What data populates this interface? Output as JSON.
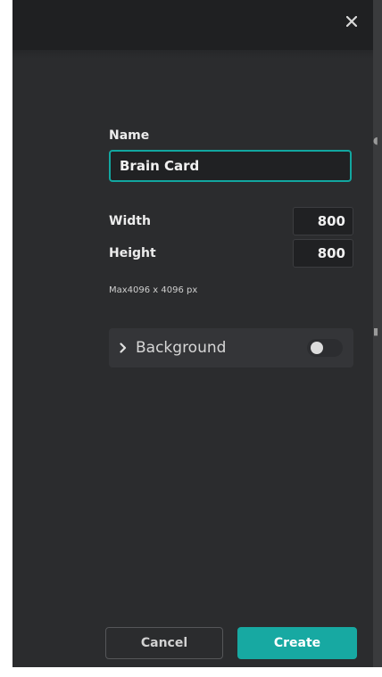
{
  "dialog": {
    "close_icon": "close-icon",
    "name_label": "Name",
    "name_value": "Brain Card",
    "width_label": "Width",
    "width_value": "800",
    "height_label": "Height",
    "height_value": "800",
    "max_note": "Max4096 x 4096 px",
    "background": {
      "label": "Background",
      "chevron_icon": "chevron-right-icon",
      "toggle_on": false
    },
    "cancel_label": "Cancel",
    "create_label": "Create"
  },
  "colors": {
    "accent": "#17a9a2",
    "panel": "#2b2c2e",
    "header": "#1f2022"
  }
}
